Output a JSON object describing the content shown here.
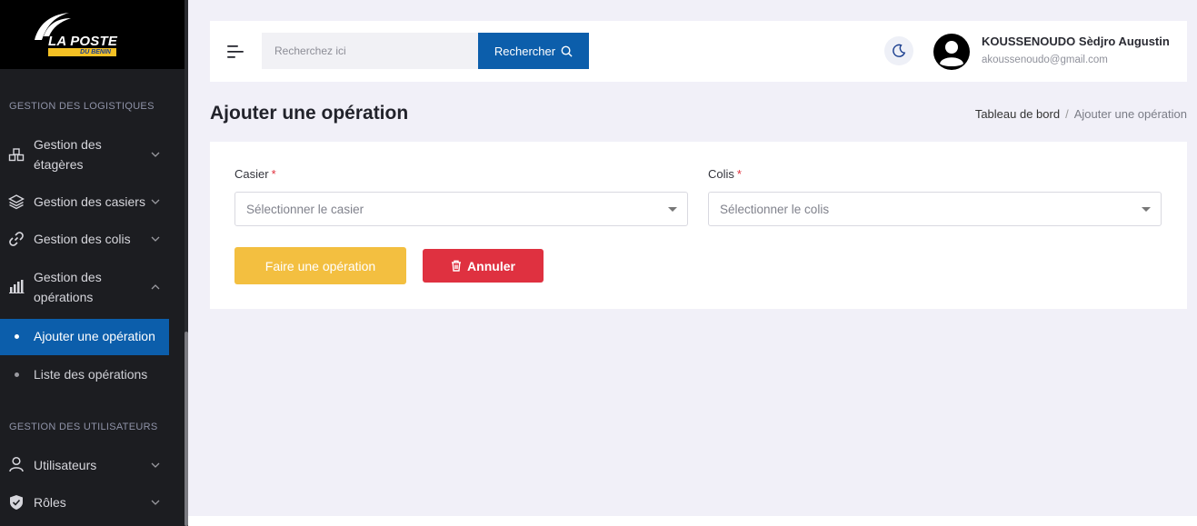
{
  "brand": {
    "name": "LA POSTE",
    "sub": "DU BENIN"
  },
  "sidebar": {
    "sections": [
      {
        "title": "GESTION DES LOGISTIQUES"
      },
      {
        "title": "GESTION DES UTILISATEURS"
      }
    ],
    "items": [
      {
        "label_line1": "Gestion des",
        "label_line2": "étagères",
        "icon": "shelves-icon"
      },
      {
        "label": "Gestion des casiers",
        "icon": "layers-icon"
      },
      {
        "label": "Gestion des colis",
        "icon": "link-icon"
      },
      {
        "label_line1": "Gestion des",
        "label_line2": "opérations",
        "icon": "chart-bars-icon"
      },
      {
        "label": "Utilisateurs",
        "icon": "user-icon"
      },
      {
        "label": "Rôles",
        "icon": "shield-icon"
      }
    ],
    "subitems": [
      {
        "label": "Ajouter une opération",
        "active": true
      },
      {
        "label": "Liste des opérations",
        "active": false
      }
    ]
  },
  "header": {
    "search_placeholder": "Recherchez ici",
    "search_button": "Rechercher",
    "user_name": "KOUSSENOUDO Sèdjro Augustin",
    "user_email": "akoussenoudo@gmail.com"
  },
  "page": {
    "title": "Ajouter une opération",
    "breadcrumb": {
      "parent": "Tableau de bord",
      "separator": "/",
      "current": "Ajouter une opération"
    }
  },
  "form": {
    "casier_label": "Casier",
    "casier_placeholder": "Sélectionner le casier",
    "colis_label": "Colis",
    "colis_placeholder": "Sélectionner le colis",
    "required_mark": "*",
    "submit_label": "Faire une opération",
    "cancel_label": "Annuler"
  },
  "colors": {
    "primary": "#0c5eab",
    "warning": "#f3bf40",
    "danger": "#df3140",
    "sidebar_bg": "#1c1d21"
  }
}
